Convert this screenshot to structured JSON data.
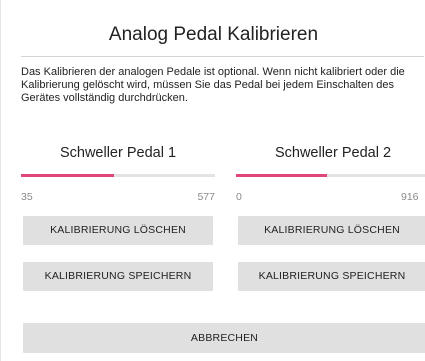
{
  "dialog": {
    "title": "Analog Pedal Kalibrieren",
    "description": "Das Kalibrieren der analogen Pedale ist optional. Wenn nicht kalibriert oder die Kalibrierung gelöscht wird, müssen Sie das Pedal bei jedem Einschalten des Gerätes vollständig durchdrücken.",
    "cancel_label": "ABBRECHEN"
  },
  "pedals": [
    {
      "name": "Schweller Pedal 1",
      "min_value": "35",
      "max_value": "577",
      "level_fraction": 0.48,
      "delete_label": "KALIBRIERUNG LÖSCHEN",
      "save_label": "KALIBRIERUNG SPEICHERN"
    },
    {
      "name": "Schweller Pedal 2",
      "min_value": "0",
      "max_value": "916",
      "level_fraction": 0.48,
      "delete_label": "KALIBRIERUNG LÖSCHEN",
      "save_label": "KALIBRIERUNG SPEICHERN"
    }
  ],
  "colors": {
    "accent": "#e0457b",
    "track": "#e3e3e3",
    "button": "#e0e0e0"
  }
}
